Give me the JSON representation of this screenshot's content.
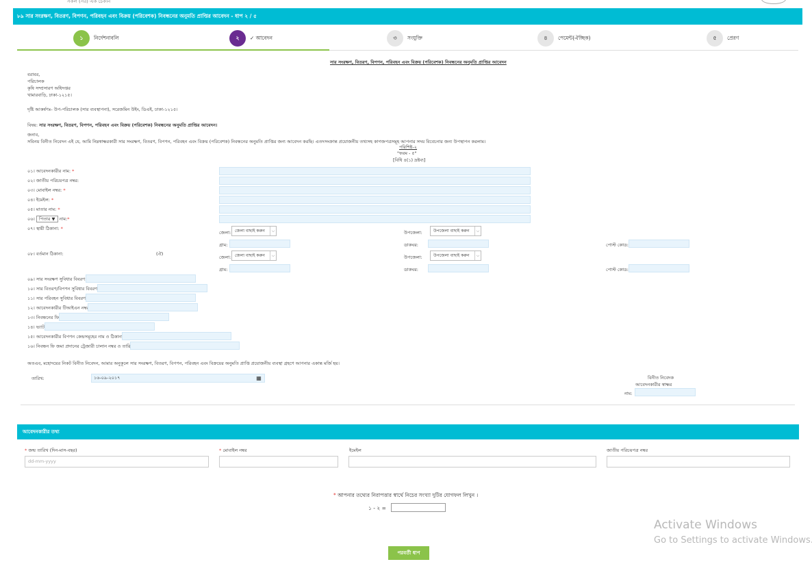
{
  "header": {
    "title": "৮৯ সার সংরক্ষণ, বিতরণ, বিপণন, পরিবহন এবং বিক্রয় (পরিবেশক) নিবন্ধনের অনুমতি প্রাপ্তির আবেদন - ধাপ ২ / ৫"
  },
  "steps": [
    {
      "num": "১",
      "label": "নির্দেশনাবলি",
      "state": "done",
      "color": "#8bc34a"
    },
    {
      "num": "২",
      "label": "✓ আবেদন",
      "state": "active",
      "color": "#6a2c91"
    },
    {
      "num": "৩",
      "label": "সংযুক্তি",
      "state": "pending",
      "color": "#e0e0e0"
    },
    {
      "num": "৪",
      "label": "পেমেন্ট(ঐচ্ছিক)",
      "state": "pending",
      "color": "#e0e0e0"
    },
    {
      "num": "৫",
      "label": "প্রেরণ",
      "state": "pending",
      "color": "#e0e0e0"
    }
  ],
  "letter": {
    "heading": "সার সংরক্ষণ, বিতরণ, বিপণন, পরিবহন এবং বিক্রয় (পরিবেশক) নিবন্ধনের অনুমতি প্রাপ্তির আবেদন",
    "address": [
      "বরাবর,",
      "পরিচালক",
      "কৃষি সম্প্রসারণ অধিদপ্তর",
      "খামারবাড়ি, ঢাকা-১২১৫।"
    ],
    "attention": "দৃষ্টি আকর্ষণঃ- উপ-পরিচালক (সার ব্যবস্থাপনা), সরেজমিন উইং, ডিএই, ঢাকা-১২১৫।",
    "subject_prefix": "বিষয়:",
    "subject": "সার সংরক্ষণ, বিতরণ, বিপণন, পরিবহন এবং বিক্রয় (পরিবেশক) নিবন্ধনের অনুমতি প্রাপ্তির আবেদন।",
    "salutation": "জনাব,",
    "body": "সবিনয় বিনীত নিবেদন এই যে, আমি নিম্নস্বাক্ষরকারী সার সংরক্ষণ, বিতরণ, বিপণন, পরিবহন এবং বিক্রয় (পরিবেশক) নিবন্ধনের অনুমতি প্রাপ্তির জন্য আবেদন করছি। এতদসংক্রান্ত প্রয়োজনীয় তথ্যসহ কাগজপত্রসমূহ আপনার সদয় বিবেচনার জন্য উপস্থাপন করলাম।",
    "appendix": "পরিশিষ্ট-২",
    "form_no": "\"ফরম - ৫\"",
    "rule": "[বিধি ৪(১) দ্রষ্টব্য]"
  },
  "form": {
    "f1": "০১। আবেদনকারীর নাম:",
    "f2": "০২। জাতীয় পরিচয়পত্র নম্বর:",
    "f3": "০৩। মোবাইল নম্বর:",
    "f4": "০৪। ইমেইল:",
    "f5": "০৫। মাতার নাম:",
    "f6_prefix": "০৬।",
    "f6_select": "পিতার",
    "f6_suffix": "নাম:",
    "f7": "০৭। স্থায়ী ঠিকানা:",
    "f8": "০৮। বর্তমান ঠিকানা:",
    "f8_same": "(ঐ)",
    "district_label": "জেলা:",
    "district_select": "জেলা বাছাই করুন",
    "upazila_label": "উপজেলা:",
    "upazila_select": "উপজেলা বাছাই করুন",
    "village_label": "গ্রাম:",
    "post_label": "ডাকঘর:",
    "postcode_label": "পোস্ট কোড:",
    "f9": "০৯। সার সংরক্ষণ সুবিধার বিবরণ:",
    "f10": "১০। সার বিতরণ/বিপণন সুবিধার বিবরণ:",
    "f11": "১১। সার পরিবহন সুবিধার বিবরণ:",
    "f12": "১২। আবেদনকারীর টিআইএন নম্বর:",
    "f13": "১৩। নিবন্ধনের ফি:",
    "f14": "১৪। ভ্যাট:",
    "f15": "১৫। আবেদনকারীর বিপণন কেন্দ্রসমূহের নাম ও ঠিকানা:",
    "f16": "১৬। নিবন্ধন ফি জমা প্রদানের ট্রেজারী চালান নম্বর ও তারিখ:"
  },
  "closing": "অতএব, মহোদয়ের নিকট বিনীত নিবেদন, আমার অনুকূলে সার সংরক্ষণ, বিতরণ, বিপণন, পরিবহন এবং বিক্রয়ের অনুমতি প্রাপ্তি প্রয়োজনীয় ব্যবস্থা গ্রহণে আপনার একান্ত মর্জি হয়।",
  "date_label": "তারিখ:",
  "date_value": "১৬-০৯-২০১৭",
  "sign": {
    "line1": "বিনীত নিবেদক",
    "line2": "আবেদনকারীর স্বাক্ষর",
    "name_label": "নাম:"
  },
  "applicant_section": {
    "title": "আবেদনকারীর তথ্য",
    "dob_label": "জন্ম তারিখ (দিন-মাস-বছর)",
    "dob_placeholder": "dd-mm-yyyy",
    "mobile_label": "মোবাইল নম্বর",
    "email_label": "ইমেইল",
    "nid_label": "জাতীয় পরিচয়পত্র নম্বর"
  },
  "captcha": {
    "prompt": "আপনার তথ্যের নিরাপত্তার স্বার্থে নিচের সংখ্যা দুটির যোগফল লিখুন ।",
    "question": "১ - ২ ="
  },
  "next_button": "পরবর্তী ধাপ",
  "watermark": {
    "line1": "Activate Windows",
    "line2": "Go to Settings to activate Windows."
  },
  "colors": {
    "header": "#00bcd4",
    "accent_green": "#8bc34a",
    "active_purple": "#6a2c91",
    "field_bg": "#e8f4fc"
  }
}
